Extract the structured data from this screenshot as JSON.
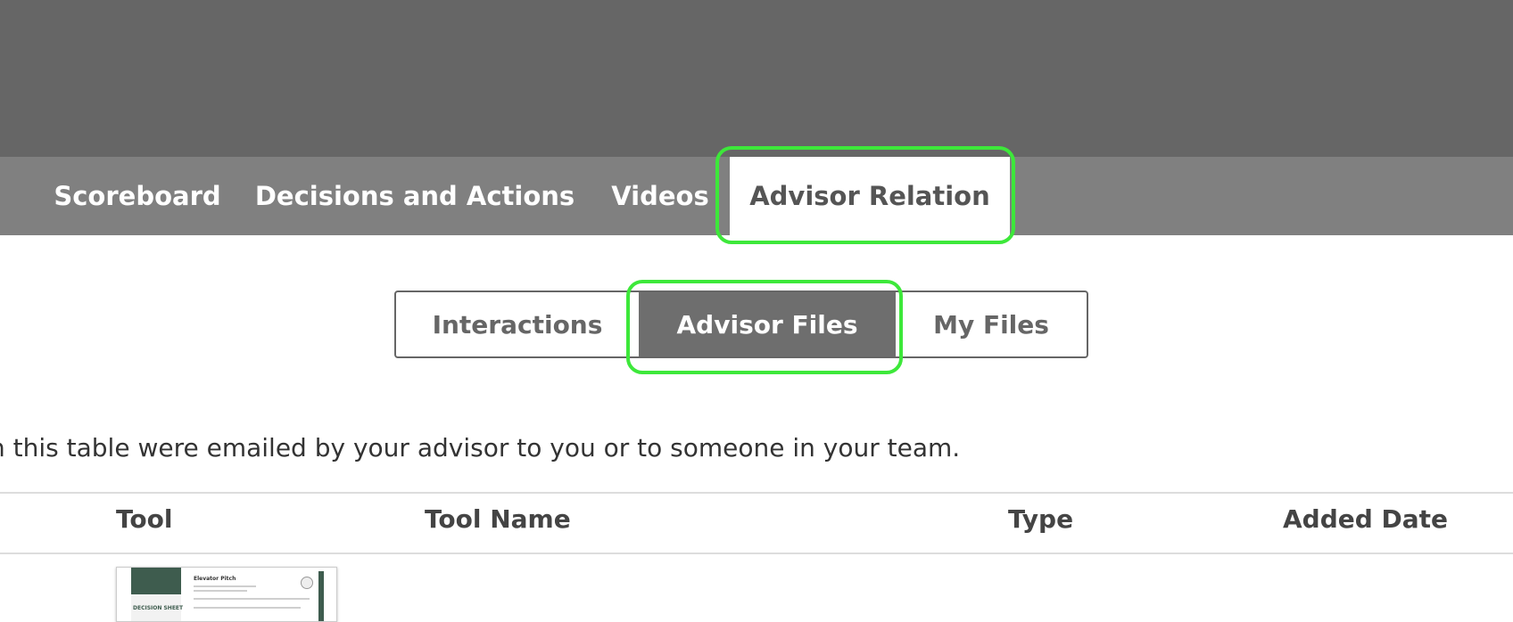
{
  "nav": {
    "tabs": [
      {
        "label": "Scoreboard",
        "active": false
      },
      {
        "label": "Decisions and Actions",
        "active": false
      },
      {
        "label": "Videos",
        "active": false
      },
      {
        "label": "Advisor Relation",
        "active": true
      }
    ]
  },
  "subtabs": [
    {
      "label": "Interactions",
      "active": false
    },
    {
      "label": "Advisor Files",
      "active": true
    },
    {
      "label": "My Files",
      "active": false
    }
  ],
  "description": "n this table were emailed by your advisor to you or to someone in your team.",
  "table": {
    "headers": [
      "Tool",
      "Tool Name",
      "Type",
      "Added Date"
    ]
  },
  "thumbnail": {
    "title": "Elevator Pitch",
    "side_label": "DECISION SHEET"
  },
  "colors": {
    "header_band": "#666666",
    "nav_bar": "#808080",
    "active_segment": "#6e6e6e",
    "highlight": "#3de83a",
    "thumbnail_accent": "#3e5c4e"
  }
}
